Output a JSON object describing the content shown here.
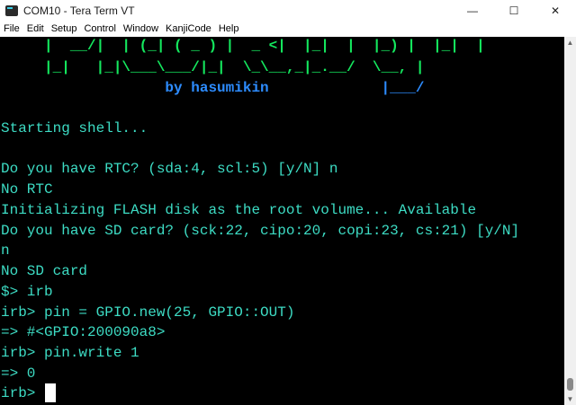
{
  "window": {
    "title": "COM10 - Tera Term VT",
    "minimize": "—",
    "maximize": "☐",
    "close": "✕",
    "app_icon": "terminal-icon"
  },
  "menu": {
    "items": [
      "File",
      "Edit",
      "Setup",
      "Control",
      "Window",
      "KanjiCode",
      "Help"
    ]
  },
  "terminal": {
    "banner_lines": [
      "     |  __/|  | (_| ( _ ) |  _ <|  |_|  |  |_) |  |_|  |",
      "     |_|   |_|\\___\\___/|_|  \\_\\__,_|_.__/  \\__, |",
      "                   by hasumikin             |___/"
    ],
    "lines": [
      "",
      "Starting shell...",
      "",
      "Do you have RTC? (sda:4, scl:5) [y/N] n",
      "No RTC",
      "Initializing FLASH disk as the root volume... Available",
      "Do you have SD card? (sck:22, cipo:20, copi:23, cs:21) [y/N]",
      "n",
      "No SD card",
      "$> irb",
      "irb> pin = GPIO.new(25, GPIO::OUT)",
      "=> #<GPIO:200090a8>",
      "irb> pin.write 1",
      "=> 0",
      "irb> "
    ],
    "colors": {
      "background": "#000000",
      "text": "#3ddcc4",
      "banner": "#14e85e",
      "byline": "#2d8cff",
      "cursor": "#ffffff"
    }
  }
}
